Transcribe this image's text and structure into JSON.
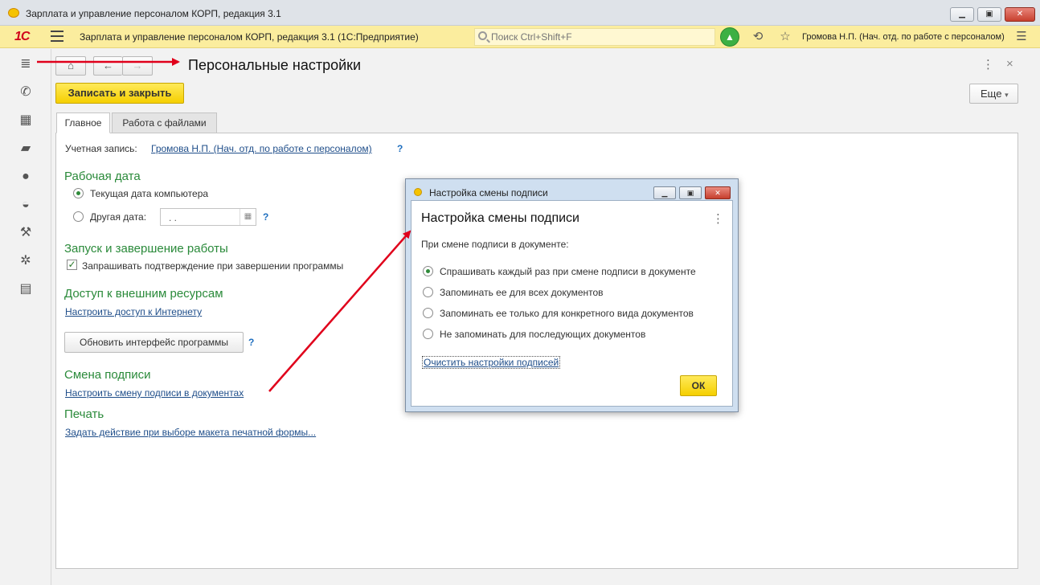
{
  "window": {
    "title": "Зарплата и управление персоналом КОРП, редакция 3.1",
    "minimize": "▁",
    "maximize": "▣",
    "close": "✕"
  },
  "toolbar": {
    "logo": "1С",
    "app_title": "Зарплата и управление персоналом КОРП, редакция 3.1  (1С:Предприятие)",
    "search_placeholder": "Поиск Ctrl+Shift+F",
    "user": "Громова Н.П. (Нач. отд. по работе с персоналом)",
    "icons": [
      "menu-icon",
      "search-icon",
      "notification-bell-icon",
      "history-icon",
      "favorites-star-icon",
      "settings-menu-icon"
    ]
  },
  "sidebar": {
    "items": [
      {
        "name": "main-menu-icon",
        "glyph": "≣"
      },
      {
        "name": "phone-icon",
        "glyph": "✆"
      },
      {
        "name": "gift-icon",
        "glyph": "▦"
      },
      {
        "name": "graduation-cap-icon",
        "glyph": "▰"
      },
      {
        "name": "people-icon",
        "glyph": "●"
      },
      {
        "name": "worker-helmet-icon",
        "glyph": "◒"
      },
      {
        "name": "wrench-icon",
        "glyph": "⚒"
      },
      {
        "name": "gear-icon",
        "glyph": "✲"
      },
      {
        "name": "card-icon",
        "glyph": "▤"
      }
    ]
  },
  "nav": {
    "home": "⌂",
    "back": "←",
    "forward": "→",
    "page_title": "Персональные настройки",
    "kebab": "⋮",
    "close": "×"
  },
  "actions": {
    "save_close": "Записать и закрыть",
    "more": "Еще",
    "more_arrow": "▾"
  },
  "tabs": [
    {
      "label": "Главное",
      "active": true
    },
    {
      "label": "Работа с файлами",
      "active": false
    }
  ],
  "main": {
    "account_label": "Учетная запись:",
    "account_value": "Громова Н.П. (Нач. отд. по работе с персоналом)",
    "help": "?",
    "work_date_title": "Рабочая дата",
    "radio_current": "Текущая дата компьютера",
    "radio_other": "Другая дата:",
    "date_value": ".  .",
    "startup_title": "Запуск и завершение работы",
    "confirm_exit": "Запрашивать подтверждение при завершении программы",
    "external_title": "Доступ к внешним ресурсам",
    "internet_link": "Настроить доступ к Интернету",
    "refresh_button": "Обновить интерфейс программы",
    "signature_title": "Смена подписи",
    "signature_link": "Настроить смену подписи в документах",
    "print_title": "Печать",
    "print_link": "Задать действие при выборе макета печатной формы..."
  },
  "dialog": {
    "window_title": "Настройка смены подписи",
    "heading": "Настройка смены подписи",
    "kebab": "⋮",
    "prompt": "При смене подписи в документе:",
    "options": [
      {
        "label": "Спрашивать каждый раз при смене подписи в документе",
        "selected": true
      },
      {
        "label": "Запоминать ее для всех документов",
        "selected": false
      },
      {
        "label": "Запоминать ее только для конкретного вида документов",
        "selected": false
      },
      {
        "label": "Не запоминать для последующих документов",
        "selected": false
      }
    ],
    "clear_link": "Очистить настройки подписей",
    "ok": "ОК"
  },
  "colors": {
    "toolbar_bg": "#fbed9e",
    "accent_yellow": "#f5cf00",
    "section_green": "#2a8a3a",
    "link_blue": "#1f4e8a",
    "annotation_red": "#e0001b"
  }
}
